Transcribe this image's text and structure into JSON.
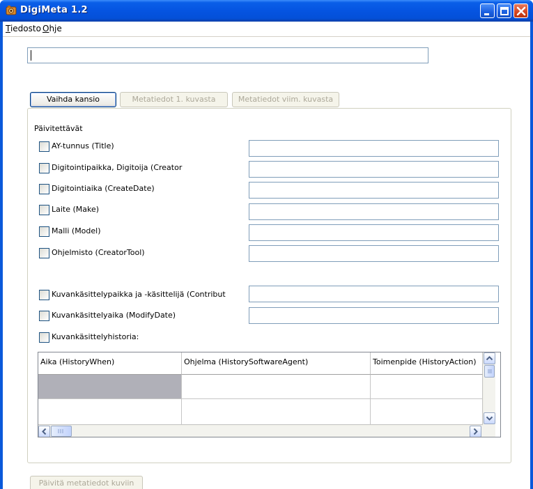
{
  "window": {
    "title": "DigiMeta 1.2",
    "icon": "app-icon",
    "controls": [
      "minimize-icon",
      "maximize-icon",
      "close-icon"
    ]
  },
  "menu": {
    "items": [
      {
        "label_first": "T",
        "label_rest": "iedosto"
      },
      {
        "label_first": "O",
        "label_rest": "hje"
      }
    ]
  },
  "folder": {
    "path_value": "",
    "buttons": {
      "change_folder": "Vaihda kansio",
      "first_image_meta": "Metatiedot 1. kuvasta",
      "last_image_meta": "Metatiedot viim. kuvasta"
    }
  },
  "update_panel": {
    "label": "Päivitettävät",
    "fields": [
      {
        "label": "AY-tunnus (Title)",
        "checked": false,
        "value": ""
      },
      {
        "label": "Digitointipaikka, Digitoija (Creator",
        "checked": false,
        "value": ""
      },
      {
        "label": "Digitointiaika (CreateDate)",
        "checked": false,
        "value": ""
      },
      {
        "label": "Laite (Make)",
        "checked": false,
        "value": ""
      },
      {
        "label": "Malli (Model)",
        "checked": false,
        "value": ""
      },
      {
        "label": "Ohjelmisto (CreatorTool)",
        "checked": false,
        "value": ""
      },
      {
        "label": "Kuvankäsittelypaikka ja -käsittelijä (Contribut",
        "checked": false,
        "value": ""
      },
      {
        "label": "Kuvankäsittelyaika (ModifyDate)",
        "checked": false,
        "value": ""
      }
    ],
    "history_label": "Kuvankäsittelyhistoria:",
    "history_table": {
      "columns": [
        "Aika (HistoryWhen)",
        "Ohjelma (HistorySoftwareAgent)",
        "Toimenpide (HistoryAction)"
      ],
      "rows": [
        [
          "",
          "",
          ""
        ],
        [
          "",
          "",
          ""
        ]
      ]
    }
  },
  "footer": {
    "update_button": "Päivitä metatiedot kuviin"
  },
  "colors": {
    "titlebar": "#0554e1",
    "close_button": "#d6451f",
    "selected_cell": "#b0b0b8"
  }
}
